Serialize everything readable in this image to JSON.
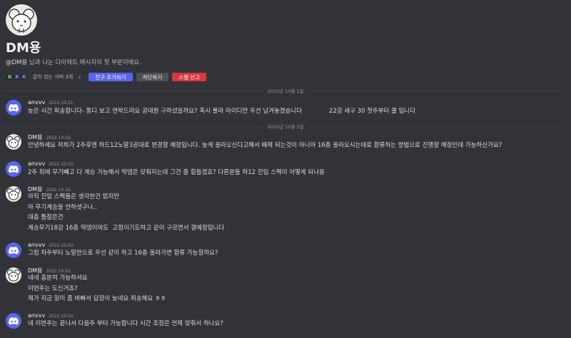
{
  "channel": {
    "title": "DM용",
    "subtitle_name": "@DM용",
    "subtitle_rest": " 님과 나눈 다이렉트 메시지의 첫 부분이에요.",
    "server_icons": [
      "K",
      "K",
      "K"
    ],
    "mutual_servers": "같이 있는 서버 3개",
    "add_friend": "친구 추가하기",
    "block": "차단하기",
    "report_spam": "스팸 신고"
  },
  "dividers": [
    "2022년 10월 1일",
    "2022년 10월 2일"
  ],
  "messages": [
    {
      "author": "anvvv",
      "time": "2022.10.01.",
      "avatar": "discord-icon",
      "lines": [
        "늦은 시간 죄송합니다- 통디 보고 연락드려요 공대원 구하셨을까요? 혹시 몰라 아이디만 우선 남겨놓겠습니다              22강 세구 30 첫주부터 쿨 입니다"
      ]
    },
    {
      "author": "DM용",
      "time": "2022.10.02.",
      "avatar": "mouse-icon",
      "lines": [
        "안녕하세요 저희가 2주후엔 하드12노말3공대로 변경할 예정입니다. 늦게 올라오신다고해서 배제 되는것이 아니아 16층 올라오시는데로 합류하는 방법으로 진행할 예정인데 가능하신가요?"
      ]
    },
    {
      "author": "anvvv",
      "time": "2022.10.02.",
      "avatar": "discord-icon",
      "lines": [
        "2주 뒤에 무기빼고 다 계승 가능해서 딱뎀은 맞춰지는데 그건 좀 힘들겠죠? 다른분들 하12 진입 스펙이 어떻게 되나용"
      ]
    },
    {
      "author": "DM용",
      "time": "2022.10.02.",
      "avatar": "mouse-icon",
      "lines": [
        "아직 진입 스펙들은 생각한건 없지만",
        "아 무기계승을 안하셧구나..",
        "대충 틀잡은건",
        "계승무기18강 16층 딱뎀이여도  고정이기도하고 같이 구르면서 갤예정입니다"
      ]
    },
    {
      "author": "anvvv",
      "time": "2022.10.02.",
      "avatar": "discord-icon",
      "lines": [
        "그럼 차주부터 노말만으로 우선 같이 하고 16층 올라가면 합류 가능할까요?"
      ]
    },
    {
      "author": "DM용",
      "time": "2022.10.02.",
      "avatar": "mouse-icon",
      "lines": [
        "네네 충분히 가능하셔요",
        "이번주는 도신거죠?",
        "제가 지금 일이 좀 바빠서 답장이 늦네요 죄송해요 ㅎㅎ"
      ]
    },
    {
      "author": "anvvv",
      "time": "2022.10.02.",
      "avatar": "discord-icon",
      "lines": [
        "네 이번주는 끝나서 다음주 부터 가능합니다 시간 조정은 언제 맞춰서 하나요?"
      ]
    }
  ]
}
